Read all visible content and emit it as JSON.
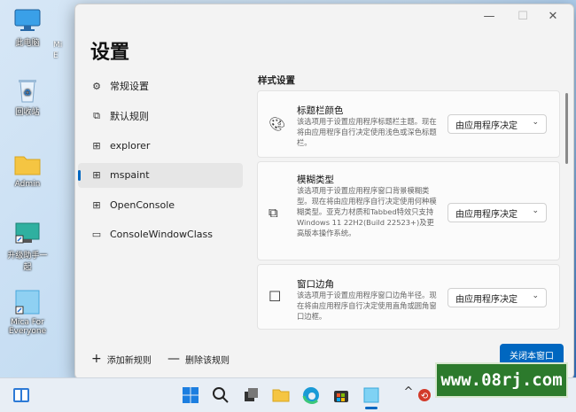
{
  "desktop": {
    "icons": [
      {
        "label": "此电脑",
        "icon": "computer-icon"
      },
      {
        "label": "回收站",
        "icon": "recycle-bin-icon"
      },
      {
        "label": "Admin",
        "icon": "folder-icon"
      },
      {
        "label": "升级助手一起",
        "icon": "shortcut-icon"
      },
      {
        "label": "Mica For Everyone",
        "icon": "app-icon"
      }
    ],
    "partial_labels": [
      "Mi",
      "E"
    ]
  },
  "window": {
    "title": "设置",
    "controls": {
      "minimize": "—",
      "maximize": "☐",
      "close": "✕"
    },
    "nav": [
      {
        "label": "常规设置",
        "icon": "gear-icon",
        "active": false
      },
      {
        "label": "默认规则",
        "icon": "rule-icon",
        "active": false
      },
      {
        "label": "explorer",
        "icon": "window-icon",
        "active": false
      },
      {
        "label": "mspaint",
        "icon": "window-icon",
        "active": true
      },
      {
        "label": "OpenConsole",
        "icon": "window-icon",
        "active": false
      },
      {
        "label": "ConsoleWindowClass",
        "icon": "window-icon",
        "active": false
      }
    ],
    "section_title": "样式设置",
    "cards": [
      {
        "title": "标题栏颜色",
        "icon": "palette-icon",
        "desc": "该选项用于设置应用程序标题栏主题。现在将由应用程序自行决定使用浅色或深色标题栏。",
        "value": "由应用程序决定"
      },
      {
        "title": "模糊类型",
        "icon": "blur-icon",
        "desc": "该选项用于设置应用程序窗口背景模糊类型。现在将由应用程序自行决定使用何种模糊类型。亚克力材质和Tabbed特效只支持Windows 11 22H2(Build 22523+)及更高版本操作系统。",
        "value": "由应用程序决定"
      },
      {
        "title": "窗口边角",
        "icon": "corner-icon",
        "desc": "该选项用于设置应用程序窗口边角半径。现在将由应用程序自行决定使用直角或圆角窗口边框。",
        "value": "由应用程序决定"
      }
    ],
    "footer": {
      "add_rule": "添加新规则",
      "delete_rule": "删除该规则",
      "close_window": "关闭本窗口"
    }
  },
  "taskbar": {
    "items": [
      "widgets-icon",
      "start-icon",
      "search-icon",
      "task-view-icon",
      "explorer-icon",
      "edge-icon",
      "store-icon",
      "mica-app-icon"
    ],
    "tray_chevron": "^"
  },
  "watermark": "www.08rj.com",
  "colors": {
    "accent": "#0067c0",
    "watermark_bg": "#2c7a2c"
  }
}
